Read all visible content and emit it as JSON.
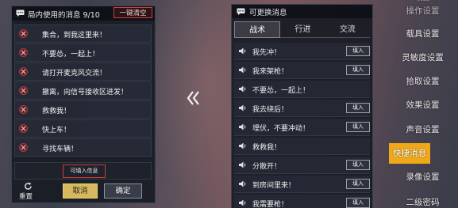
{
  "messages_panel": {
    "title": "局内使用的消息 9/10",
    "clear_all_label": "一键清空",
    "messages": [
      "集合，到我这里来！",
      "不要怂，一起上！",
      "请打开麦克风交流！",
      "撤离，向信号接收区进发！",
      "救救我！",
      "快上车！",
      "寻找车辆！"
    ],
    "fill_hint": "可填入信息",
    "reset_label": "重置",
    "cancel_label": "取消",
    "confirm_label": "确定"
  },
  "quick_panel": {
    "title": "可更换消息",
    "tabs": [
      "战术",
      "行进",
      "交流"
    ],
    "active_tab": "战术",
    "fill_label": "填入",
    "items": [
      "我先冲！",
      "我来架枪！",
      "不要怂，一起上！",
      "我去绕后！",
      "埋伏，不要冲动！",
      "救救我！",
      "分散开！",
      "到房间里来！",
      "我需要枪！"
    ]
  },
  "sidebar": {
    "items": [
      {
        "label": "操作设置",
        "state": "dim"
      },
      {
        "label": "载具设置",
        "state": "normal"
      },
      {
        "label": "灵敏度设置",
        "state": "normal"
      },
      {
        "label": "拾取设置",
        "state": "normal"
      },
      {
        "label": "效果设置",
        "state": "normal"
      },
      {
        "label": "声音设置",
        "state": "normal"
      },
      {
        "label": "快捷消息",
        "state": "active"
      },
      {
        "label": "录像设置",
        "state": "normal"
      },
      {
        "label": "二级密码",
        "state": "normal"
      }
    ],
    "top_partial": "设置"
  },
  "colors": {
    "accent_active": "#f0a818",
    "cancel_gold": "#d6b95e",
    "remove_red": "#b0383c"
  }
}
